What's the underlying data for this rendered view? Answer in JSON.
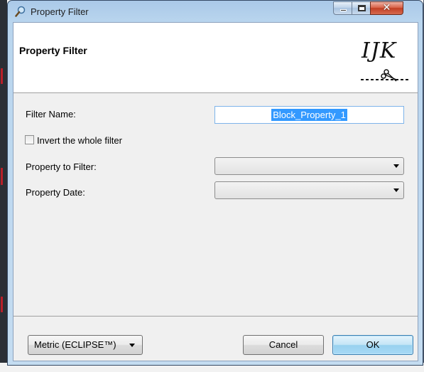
{
  "window": {
    "title": "Property Filter"
  },
  "header": {
    "title": "Property Filter",
    "logo_text": "IJK"
  },
  "form": {
    "filter_name_label": "Filter Name:",
    "filter_name_value": "Block_Property_1",
    "invert_label": "Invert the whole filter",
    "invert_checked": false,
    "property_label": "Property to Filter:",
    "property_value": "",
    "date_label": "Property Date:",
    "date_value": ""
  },
  "footer": {
    "units_label": "Metric (ECLIPSE™)",
    "cancel_label": "Cancel",
    "ok_label": "OK"
  },
  "colors": {
    "selection": "#3399ff",
    "close_button": "#c23f24",
    "ok_button": "#98d1ef"
  },
  "icons": {
    "window_icon": "magnifier-icon",
    "logo_graphic": "scissors-icon"
  }
}
